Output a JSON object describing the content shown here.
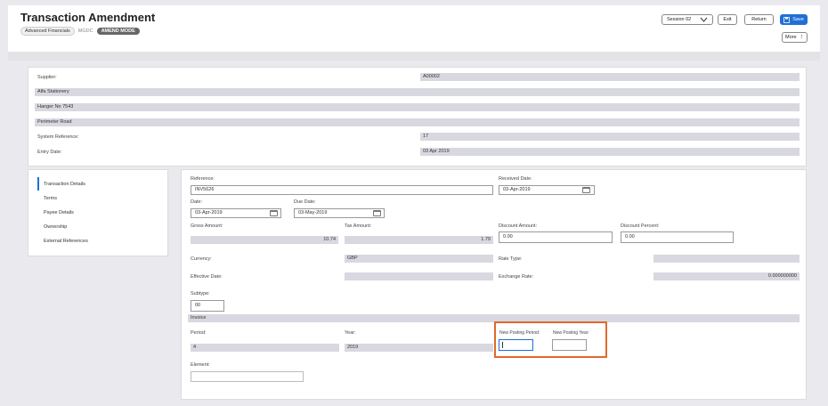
{
  "header": {
    "title": "Transaction Amendment",
    "app": "Advanced Financials",
    "company": "MGDC",
    "mode": "AMEND MODE",
    "session": "Session 02",
    "exit": "Exit",
    "return": "Return",
    "save": "Save",
    "more": "More"
  },
  "supplier": {
    "supplier_label": "Supplier:",
    "supplier_code": "A00002",
    "name": "Alfa Stationery",
    "address1": "Hanger No 7543",
    "address2": "Perimeter Road",
    "sysref_label": "System Reference:",
    "sysref_value": "17",
    "entry_label": "Entry Date:",
    "entry_value": "03 Apr 2019"
  },
  "nav": {
    "items": [
      "Transaction Details",
      "Terms",
      "Payee Details",
      "Ownership",
      "External References"
    ]
  },
  "form": {
    "reference_label": "Reference:",
    "reference_value": "INV5626",
    "received_label": "Received Date:",
    "received_value": "03-Apr-2019",
    "date_label": "Date:",
    "date_value": "03-Apr-2019",
    "due_label": "Due Date:",
    "due_value": "03-May-2019",
    "gross_label": "Gross Amount:",
    "gross_value": "10.74",
    "tax_label": "Tax Amount:",
    "tax_value": "1.79",
    "discount_amount_label": "Discount Amount:",
    "discount_amount_value": "0.00",
    "discount_percent_label": "Discount Percent:",
    "discount_percent_value": "0.00",
    "currency_label": "Currency:",
    "currency_value": "GBP",
    "rate_type_label": "Rate Type:",
    "effective_label": "Effective Date:",
    "exchange_label": "Exchange Rate:",
    "exchange_value": "0.000000000",
    "subtype_label": "Subtype:",
    "subtype_value": "00",
    "subtype_desc": "Invoice",
    "period_label": "Period:",
    "period_value": "4",
    "year_label": "Year:",
    "year_value": "2019",
    "new_period_label": "New Posting Period:",
    "new_year_label": "New Posting Year:",
    "element_label": "Element:"
  }
}
